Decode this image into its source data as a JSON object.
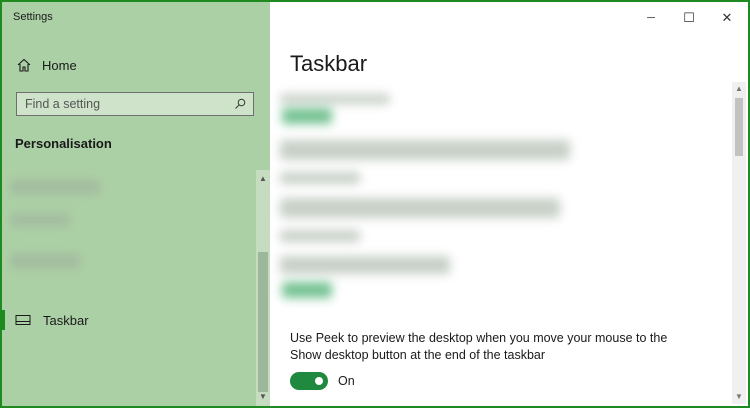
{
  "window": {
    "title": "Settings"
  },
  "sidebar": {
    "home_label": "Home",
    "search": {
      "placeholder": "Find a setting",
      "value": ""
    },
    "section_title": "Personalisation",
    "selected_item_label": "Taskbar"
  },
  "main": {
    "title": "Taskbar",
    "peek_setting": {
      "description": "Use Peek to preview the desktop when you move your mouse to the Show desktop button at the end of the taskbar",
      "toggle_state": "On"
    }
  },
  "window_controls": {
    "minimize": "─",
    "maximize": "☐",
    "close": "✕"
  },
  "colors": {
    "accent": "#1f8a3f",
    "sidebar_bg": "#acd0a5",
    "border": "#1f8a1f"
  },
  "icons": {
    "home": "home-icon",
    "search": "search-icon",
    "taskbar": "taskbar-icon"
  }
}
